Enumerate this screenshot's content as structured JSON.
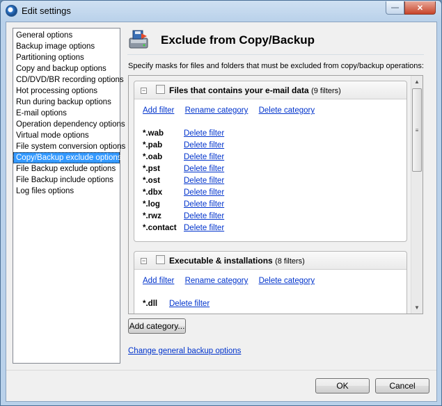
{
  "window": {
    "title": "Edit settings",
    "minimize_glyph": "—",
    "close_glyph": "✕"
  },
  "nav": {
    "items": [
      {
        "label": "General options"
      },
      {
        "label": "Backup image options"
      },
      {
        "label": "Partitioning options"
      },
      {
        "label": "Copy and backup options"
      },
      {
        "label": "CD/DVD/BR recording options"
      },
      {
        "label": "Hot processing options"
      },
      {
        "label": "Run during backup options"
      },
      {
        "label": "E-mail options"
      },
      {
        "label": "Operation dependency options"
      },
      {
        "label": "Virtual mode options"
      },
      {
        "label": "File system conversion options"
      },
      {
        "label": "Copy/Backup exclude options",
        "selected": true
      },
      {
        "label": "File Backup exclude options"
      },
      {
        "label": "File Backup include options"
      },
      {
        "label": "Log files options"
      }
    ]
  },
  "page": {
    "title": "Exclude from Copy/Backup",
    "description": "Specify masks for files and folders that must be excluded from copy/backup operations:",
    "header_icon": "backup-drive-icon"
  },
  "categories": [
    {
      "name": "Files that contains your e-mail data",
      "count": "(9 filters)",
      "checked": false,
      "add_filter": "Add filter",
      "rename": "Rename category",
      "delete": "Delete category",
      "filters": [
        {
          "mask": "*.wab",
          "delete": "Delete filter"
        },
        {
          "mask": "*.pab",
          "delete": "Delete filter"
        },
        {
          "mask": "*.oab",
          "delete": "Delete filter"
        },
        {
          "mask": "*.pst",
          "delete": "Delete filter"
        },
        {
          "mask": "*.ost",
          "delete": "Delete filter"
        },
        {
          "mask": "*.dbx",
          "delete": "Delete filter"
        },
        {
          "mask": "*.log",
          "delete": "Delete filter"
        },
        {
          "mask": "*.rwz",
          "delete": "Delete filter"
        },
        {
          "mask": "*.contact",
          "delete": "Delete filter"
        }
      ]
    },
    {
      "name": "Executable & installations",
      "count": "(8 filters)",
      "checked": false,
      "add_filter": "Add filter",
      "rename": "Rename category",
      "delete": "Delete category",
      "filters": [
        {
          "mask": "*.dll",
          "delete": "Delete filter"
        }
      ]
    }
  ],
  "scrollbar": {
    "up": "▲",
    "down": "▼",
    "grip": "≡"
  },
  "buttons": {
    "add_category": "Add category...",
    "change_general": "Change general backup options",
    "ok": "OK",
    "cancel": "Cancel"
  },
  "colors": {
    "selection": "#3399ff",
    "link": "#0033cc"
  }
}
